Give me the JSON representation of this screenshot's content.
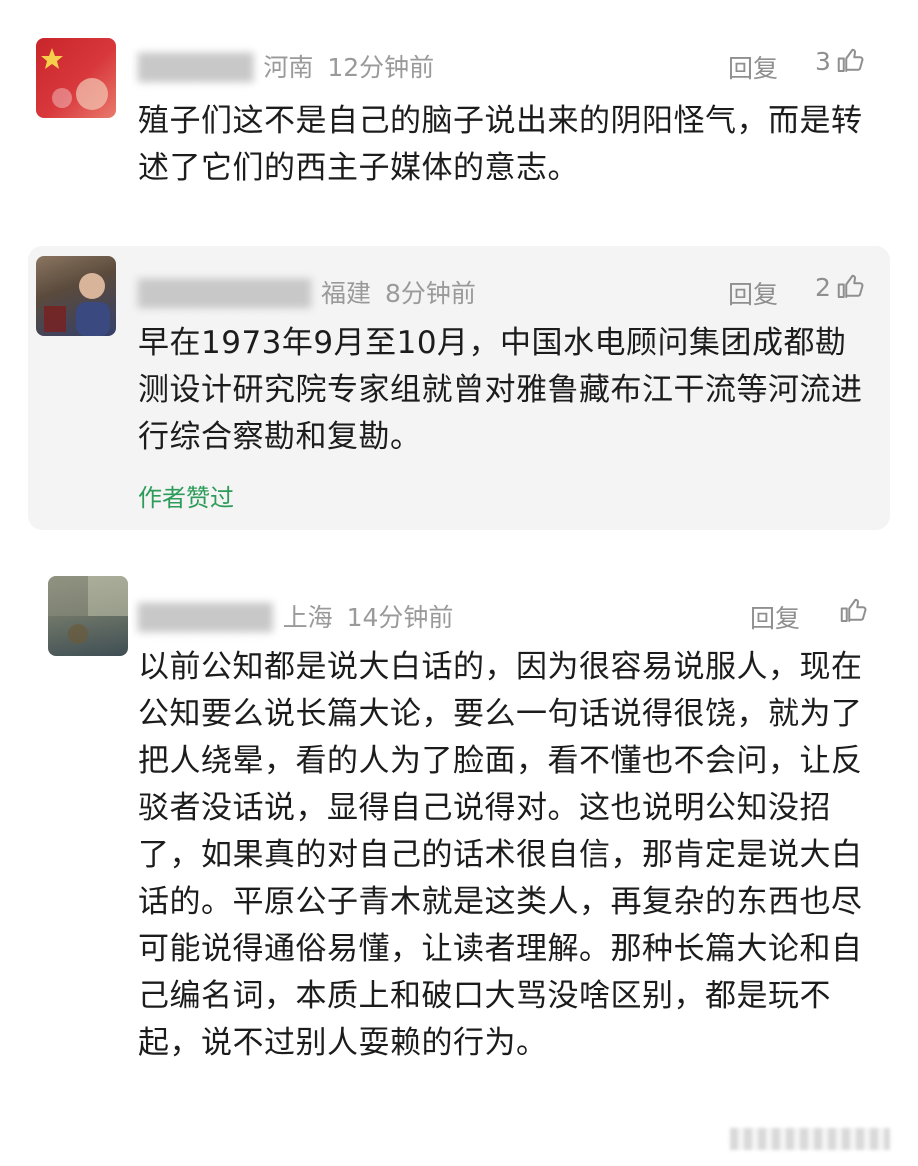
{
  "comments": [
    {
      "location": "河南",
      "time": "12分钟前",
      "reply_label": "回复",
      "likes": "3",
      "text": "殖子们这不是自己的脑子说出来的阴阳怪气，而是转述了它们的西主子媒体的意志。",
      "avatar_colors": [
        "#c8252b",
        "#e2585a",
        "#f3d9c9"
      ]
    },
    {
      "location": "福建",
      "time": "8分钟前",
      "reply_label": "回复",
      "likes": "2",
      "text": "早在1973年9月至10月，中国水电顾问集团成都勘测设计研究院专家组就曾对雅鲁藏布江干流等河流进行综合察勘和复勘。",
      "tag": "作者赞过",
      "avatar_colors": [
        "#6e5a48",
        "#3b4a72",
        "#c9a28a"
      ]
    },
    {
      "location": "上海",
      "time": "14分钟前",
      "reply_label": "回复",
      "likes": "",
      "text": "以前公知都是说大白话的，因为很容易说服人，现在公知要么说长篇大论，要么一句话说得很饶，就为了把人绕晕，看的人为了脸面，看不懂也不会问，让反驳者没话说，显得自己说得对。这也说明公知没招了，如果真的对自己的话术很自信，那肯定是说大白话的。平原公子青木就是这类人，再复杂的东西也尽可能说得通俗易懂，让读者理解。那种长篇大论和自己编名词，本质上和破口大骂没啥区别，都是玩不起，说不过别人耍赖的行为。",
      "avatar_colors": [
        "#7a7e72",
        "#4c5a5a",
        "#9ea092"
      ]
    }
  ]
}
